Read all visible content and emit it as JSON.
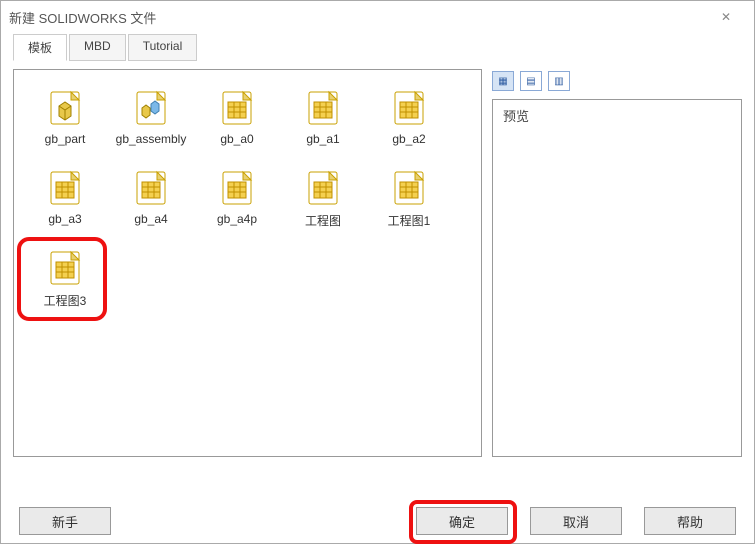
{
  "window": {
    "title": "新建 SOLIDWORKS 文件"
  },
  "tabs": {
    "t0": "模板",
    "t1": "MBD",
    "t2": "Tutorial",
    "activeIndex": 0
  },
  "files": {
    "items": [
      {
        "label": "gb_part",
        "kind": "part"
      },
      {
        "label": "gb_assembly",
        "kind": "assembly"
      },
      {
        "label": "gb_a0",
        "kind": "drawing"
      },
      {
        "label": "gb_a1",
        "kind": "drawing"
      },
      {
        "label": "gb_a2",
        "kind": "drawing"
      },
      {
        "label": "gb_a3",
        "kind": "drawing"
      },
      {
        "label": "gb_a4",
        "kind": "drawing"
      },
      {
        "label": "gb_a4p",
        "kind": "drawing"
      },
      {
        "label": "工程图",
        "kind": "drawing"
      },
      {
        "label": "工程图1",
        "kind": "drawing"
      },
      {
        "label": "工程图3",
        "kind": "drawing"
      }
    ]
  },
  "preview": {
    "label": "预览"
  },
  "buttons": {
    "novice": "新手",
    "ok": "确定",
    "cancel": "取消",
    "help": "帮助"
  },
  "highlights": {
    "itemIndex": 10,
    "okButton": true
  }
}
